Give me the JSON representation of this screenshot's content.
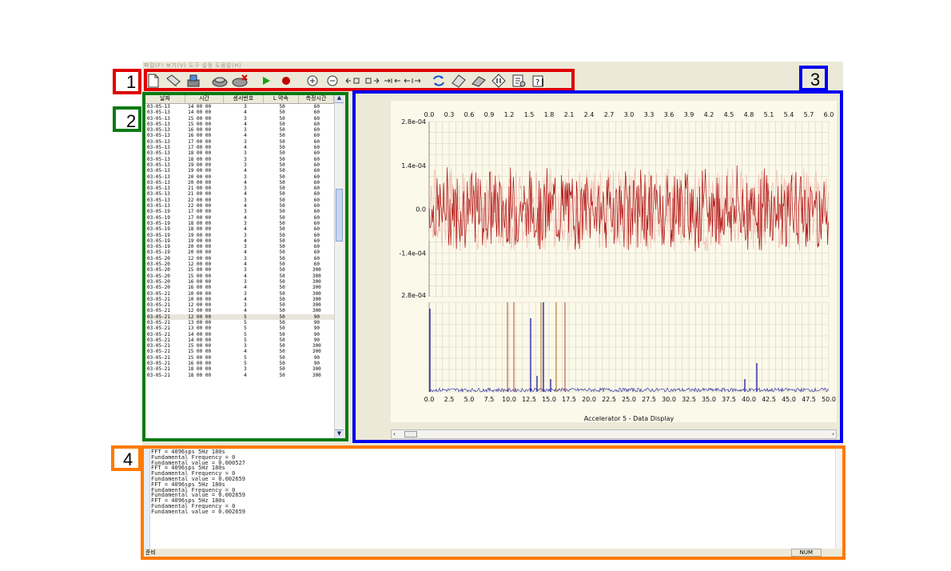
{
  "menu": {
    "text": "파일(F)  보기(V)  도구  설정  도움말(H)"
  },
  "toolbar": {
    "icons": [
      "new-file-icon",
      "open-icon",
      "save-icon",
      "connect-icon",
      "disconnect-icon",
      "play-icon",
      "record-icon",
      "zoom-in-icon",
      "zoom-out-icon",
      "shift-left-icon",
      "shift-right-icon",
      "expand-icon",
      "shrink-icon",
      "refresh-icon",
      "settings-icon",
      "stats-icon",
      "pause-icon",
      "report-icon",
      "help-icon"
    ]
  },
  "callouts": [
    {
      "num": "1",
      "color": "#e00000"
    },
    {
      "num": "2",
      "color": "#0a7a14"
    },
    {
      "num": "3",
      "color": "#0000ee"
    },
    {
      "num": "4",
      "color": "#ff7a00"
    }
  ],
  "list": {
    "columns": [
      "날짜",
      "시간",
      "센서번호",
      "L 약속",
      "측정시간"
    ],
    "rows": [
      [
        "03-05-13",
        "14 00 00",
        "3",
        "50",
        "60"
      ],
      [
        "03-05-13",
        "14 00 00",
        "4",
        "50",
        "60"
      ],
      [
        "03-05-13",
        "15 00 00",
        "3",
        "50",
        "60"
      ],
      [
        "03-05-13",
        "15 00 00",
        "4",
        "50",
        "60"
      ],
      [
        "03-05-13",
        "16 00 00",
        "3",
        "50",
        "60"
      ],
      [
        "03-05-13",
        "16 00 00",
        "4",
        "50",
        "60"
      ],
      [
        "03-05-13",
        "17 00 00",
        "3",
        "50",
        "60"
      ],
      [
        "03-05-13",
        "17 00 00",
        "4",
        "50",
        "60"
      ],
      [
        "03-05-13",
        "18 00 00",
        "3",
        "50",
        "60"
      ],
      [
        "03-05-13",
        "18 00 00",
        "3",
        "50",
        "60"
      ],
      [
        "03-05-13",
        "19 00 00",
        "3",
        "50",
        "60"
      ],
      [
        "03-05-13",
        "19 00 00",
        "4",
        "50",
        "60"
      ],
      [
        "03-05-13",
        "20 00 00",
        "3",
        "50",
        "60"
      ],
      [
        "03-05-13",
        "20 00 00",
        "4",
        "50",
        "60"
      ],
      [
        "03-05-13",
        "21 00 00",
        "3",
        "50",
        "60"
      ],
      [
        "03-05-13",
        "21 00 00",
        "4",
        "50",
        "60"
      ],
      [
        "03-05-13",
        "22 00 00",
        "3",
        "50",
        "60"
      ],
      [
        "03-05-13",
        "22 00 00",
        "4",
        "50",
        "60"
      ],
      [
        "03-05-19",
        "17 00 00",
        "3",
        "50",
        "60"
      ],
      [
        "03-05-19",
        "17 00 00",
        "4",
        "50",
        "60"
      ],
      [
        "03-05-19",
        "18 00 00",
        "3",
        "50",
        "60"
      ],
      [
        "03-05-19",
        "18 00 00",
        "4",
        "50",
        "60"
      ],
      [
        "03-05-19",
        "19 00 00",
        "3",
        "50",
        "60"
      ],
      [
        "03-05-19",
        "19 00 00",
        "4",
        "50",
        "60"
      ],
      [
        "03-05-19",
        "20 00 00",
        "3",
        "50",
        "60"
      ],
      [
        "03-05-19",
        "20 00 00",
        "4",
        "50",
        "60"
      ],
      [
        "03-05-20",
        "12 00 00",
        "3",
        "50",
        "60"
      ],
      [
        "03-05-20",
        "12 00 00",
        "4",
        "50",
        "60"
      ],
      [
        "03-05-20",
        "15 00 00",
        "3",
        "50",
        "300"
      ],
      [
        "03-05-20",
        "15 00 00",
        "4",
        "50",
        "300"
      ],
      [
        "03-05-20",
        "16 00 00",
        "3",
        "50",
        "300"
      ],
      [
        "03-05-20",
        "16 00 00",
        "4",
        "50",
        "300"
      ],
      [
        "03-05-21",
        "10 00 00",
        "3",
        "50",
        "300"
      ],
      [
        "03-05-21",
        "10 00 00",
        "4",
        "50",
        "300"
      ],
      [
        "03-05-21",
        "12 00 00",
        "3",
        "50",
        "300"
      ],
      [
        "03-05-21",
        "12 00 00",
        "4",
        "50",
        "300"
      ],
      [
        "03-05-21",
        "12 00 00",
        "5",
        "50",
        "90"
      ],
      [
        "03-05-21",
        "13 00 00",
        "5",
        "50",
        "90"
      ],
      [
        "03-05-21",
        "13 00 00",
        "5",
        "50",
        "90"
      ],
      [
        "03-05-21",
        "14 00 00",
        "5",
        "50",
        "90"
      ],
      [
        "03-05-21",
        "14 00 00",
        "5",
        "50",
        "90"
      ],
      [
        "03-05-21",
        "15 00 00",
        "3",
        "50",
        "300"
      ],
      [
        "03-05-21",
        "15 00 00",
        "4",
        "50",
        "300"
      ],
      [
        "03-05-21",
        "15 00 00",
        "5",
        "50",
        "90"
      ],
      [
        "03-05-21",
        "16 00 00",
        "5",
        "50",
        "90"
      ],
      [
        "03-05-21",
        "18 00 00",
        "3",
        "50",
        "300"
      ],
      [
        "03-05-21",
        "18 00 00",
        "4",
        "50",
        "300"
      ]
    ],
    "selected_index": 36
  },
  "chart_data": [
    {
      "type": "line",
      "title": "",
      "xlabel": "",
      "x_ticks": [
        "0.0",
        "0.3",
        "0.6",
        "0.9",
        "1.2",
        "1.5",
        "1.8",
        "2.1",
        "2.4",
        "2.7",
        "3.0",
        "3.3",
        "3.6",
        "3.9",
        "4.2",
        "4.5",
        "4.8",
        "5.1",
        "5.4",
        "5.7",
        "6.0"
      ],
      "y_ticks": [
        "2.8e-04",
        "1.4e-04",
        "0.0",
        "-1.4e-04"
      ],
      "xlim": [
        0,
        6.0
      ],
      "ylim": [
        -0.00028,
        0.00028
      ],
      "grid": true,
      "series": [
        {
          "color": "#b01010",
          "description_of_shape": "dense random-like vibration signal, amplitude roughly ±1.4e-04 with occasional peaks up to ~1.7e-04"
        }
      ]
    },
    {
      "type": "bar",
      "title": "Accelerator 5 - Data Display",
      "x_ticks": [
        "0.0",
        "2.5",
        "5.0",
        "7.5",
        "10.0",
        "12.5",
        "15.0",
        "17.5",
        "20.0",
        "22.5",
        "25.0",
        "27.5",
        "30.0",
        "32.5",
        "35.0",
        "37.5",
        "40.0",
        "42.5",
        "45.0",
        "47.5",
        "50.0"
      ],
      "y_ticks": [
        "2.8e-04"
      ],
      "xlim": [
        0,
        50
      ],
      "ylim": [
        0,
        0.00028
      ],
      "grid": true,
      "peaks": [
        {
          "x": 0.1,
          "y": 0.00026
        },
        {
          "x": 12.7,
          "y": 0.00023
        },
        {
          "x": 14.3,
          "y": 0.00028
        },
        {
          "x": 13.5,
          "y": 5e-05
        },
        {
          "x": 15.2,
          "y": 4e-05
        },
        {
          "x": 39.5,
          "y": 4e-05
        },
        {
          "x": 41.0,
          "y": 9e-05
        }
      ],
      "markers": [
        {
          "x": 9.8,
          "color": "#c04030"
        },
        {
          "x": 10.6,
          "color": "#c04030"
        },
        {
          "x": 14.0,
          "color": "#c07020"
        },
        {
          "x": 15.9,
          "color": "#c07020"
        },
        {
          "x": 17.0,
          "color": "#c04030"
        }
      ]
    }
  ],
  "log": {
    "lines": [
      "FFT = 4096sps 5Hz 180s",
      "Fundamental Frequency = 0",
      "Fundamental value = 0.000527",
      "FFT = 4096sps 5Hz 180s",
      "Fundamental Frequency = 0",
      "Fundamental value = 0.002659",
      "FFT = 4096sps 5Hz 180s",
      "Fundamental Frequency = 0",
      "Fundamental value = 0.002659",
      "FFT = 4096sps 5Hz 180s",
      "Fundamental Frequency = 0",
      "Fundamental value = 0.002659"
    ]
  },
  "status": {
    "left": "준비",
    "right": "NUM"
  }
}
